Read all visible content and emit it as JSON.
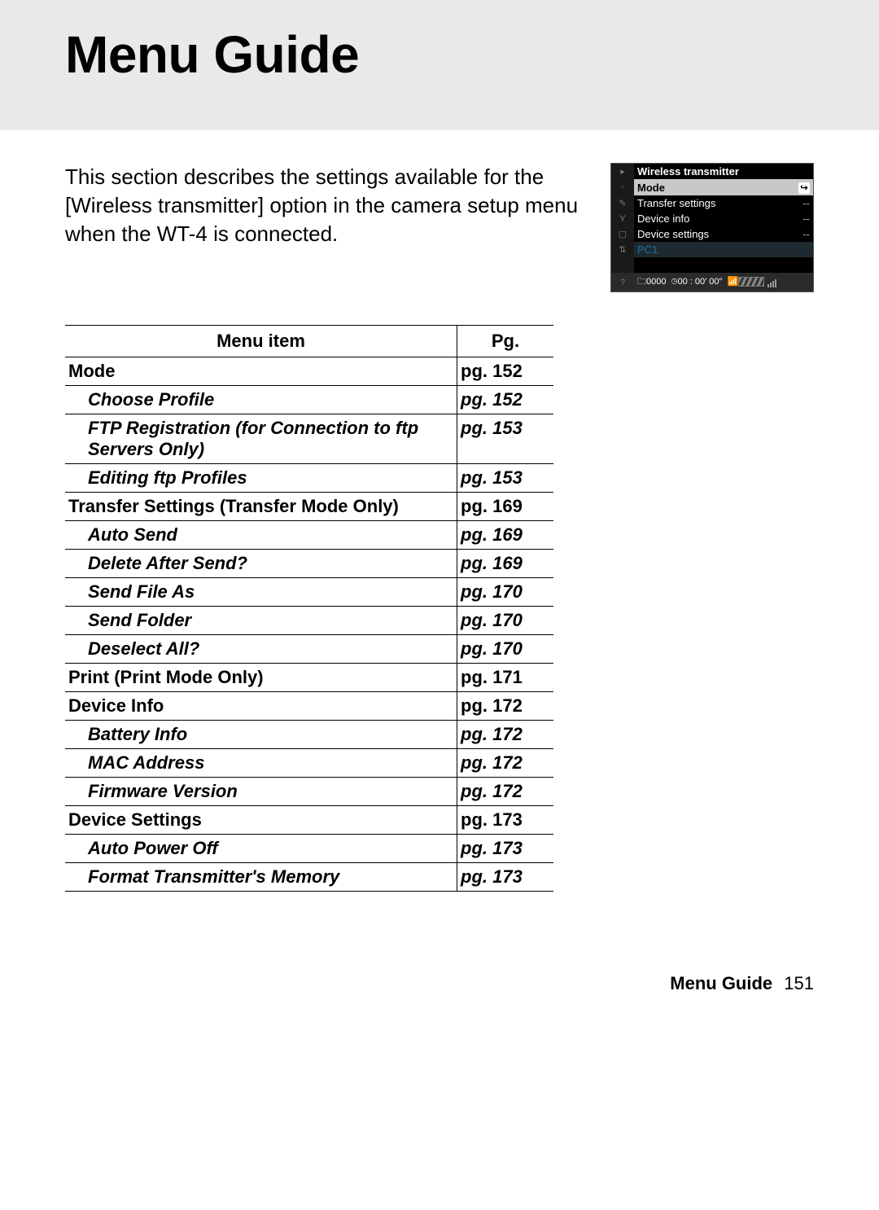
{
  "header": {
    "title": "Menu Guide"
  },
  "intro": "This section describes the settings available for the [Wireless transmitter] option in the camera setup menu when the WT-4 is connected.",
  "camera": {
    "title": "Wireless transmitter",
    "rows": [
      {
        "label": "Mode",
        "value": "",
        "selected": true
      },
      {
        "label": "Transfer settings",
        "value": "--"
      },
      {
        "label": "Device info",
        "value": "--"
      },
      {
        "label": "Device settings",
        "value": "--"
      }
    ],
    "profile": "PC1",
    "status_count": "0000",
    "status_time": "00 : 00′ 00″"
  },
  "table": {
    "headers": {
      "item": "Menu item",
      "pg": "Pg."
    },
    "rows": [
      {
        "type": "cat",
        "name": "Mode",
        "pg": "pg. 152"
      },
      {
        "type": "sub",
        "name": "Choose Profile",
        "pg": "pg. 152"
      },
      {
        "type": "sub",
        "name": "FTP Registration (for Connection to ftp Servers Only)",
        "pg": "pg. 153"
      },
      {
        "type": "sub",
        "name": "Editing ftp Profiles",
        "pg": "pg. 153"
      },
      {
        "type": "cat",
        "name": "Transfer Settings (Transfer Mode Only)",
        "pg": "pg. 169"
      },
      {
        "type": "sub",
        "name": "Auto Send",
        "pg": "pg. 169"
      },
      {
        "type": "sub",
        "name": "Delete After Send?",
        "pg": "pg. 169"
      },
      {
        "type": "sub",
        "name": "Send File As",
        "pg": "pg. 170"
      },
      {
        "type": "sub",
        "name": "Send Folder",
        "pg": "pg. 170"
      },
      {
        "type": "sub",
        "name": "Deselect All?",
        "pg": "pg. 170"
      },
      {
        "type": "cat",
        "name": "Print  (Print Mode Only)",
        "pg": "pg. 171"
      },
      {
        "type": "cat",
        "name": "Device Info",
        "pg": "pg. 172"
      },
      {
        "type": "sub",
        "name": "Battery Info",
        "pg": "pg. 172"
      },
      {
        "type": "sub",
        "name": "MAC Address",
        "pg": "pg. 172"
      },
      {
        "type": "sub",
        "name": "Firmware Version",
        "pg": "pg. 172"
      },
      {
        "type": "cat",
        "name": "Device Settings",
        "pg": "pg. 173"
      },
      {
        "type": "sub",
        "name": "Auto Power Off",
        "pg": "pg. 173"
      },
      {
        "type": "sub",
        "name": "Format Transmitter's Memory",
        "pg": "pg. 173"
      }
    ]
  },
  "footer": {
    "title": "Menu Guide",
    "page": "151"
  }
}
